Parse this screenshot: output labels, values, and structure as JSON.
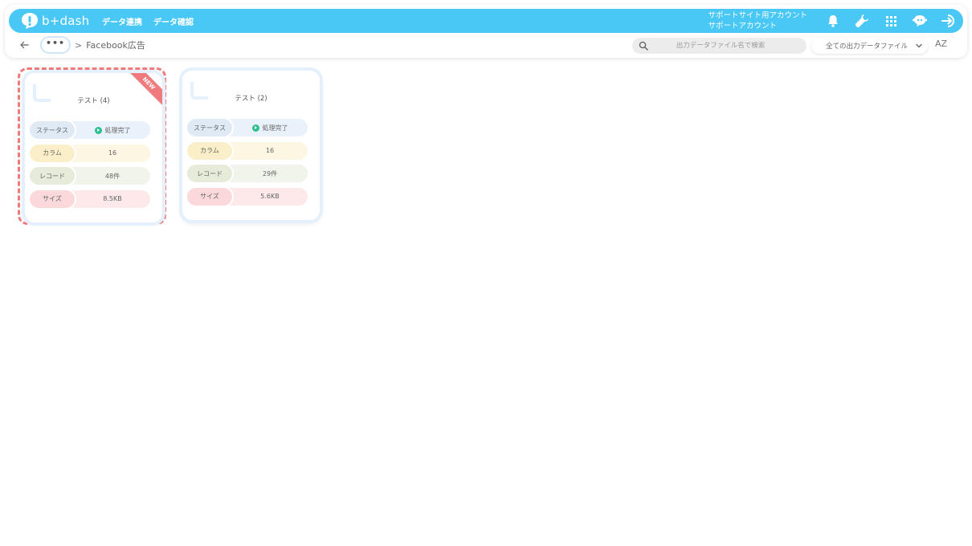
{
  "header": {
    "logo_text": "b+dash",
    "nav": [
      "データ連携",
      "データ確認"
    ],
    "account_line1": "サポートサイト用アカウント",
    "account_line2": "サポートアカウント",
    "icons": [
      "bell-icon",
      "wrench-icon",
      "apps-grid-icon",
      "chat-bot-icon",
      "logout-icon"
    ],
    "accent": "#49c8f5"
  },
  "subbar": {
    "more": "•••",
    "separator": ">",
    "breadcrumb": "Facebook広告",
    "search_placeholder": "出力データファイル名で検索",
    "filter_value": "全ての出力データファイル",
    "sort_label": "AZ"
  },
  "cards": [
    {
      "title": "テスト (4)",
      "badge": "NEW",
      "selected": true,
      "rows": {
        "status_label": "ステータス",
        "status_value": "処理完了",
        "column_label": "カラム",
        "column_value": "16",
        "record_label": "レコード",
        "record_value": "48件",
        "size_label": "サイズ",
        "size_value": "8.5KB"
      }
    },
    {
      "title": "テスト (2)",
      "badge": "",
      "selected": false,
      "rows": {
        "status_label": "ステータス",
        "status_value": "処理完了",
        "column_label": "カラム",
        "column_value": "16",
        "record_label": "レコード",
        "record_value": "29件",
        "size_label": "サイズ",
        "size_value": "5.6KB"
      }
    }
  ],
  "colors": {
    "selected_border": "#f07b7e",
    "status_ok": "#2fbf8f"
  }
}
